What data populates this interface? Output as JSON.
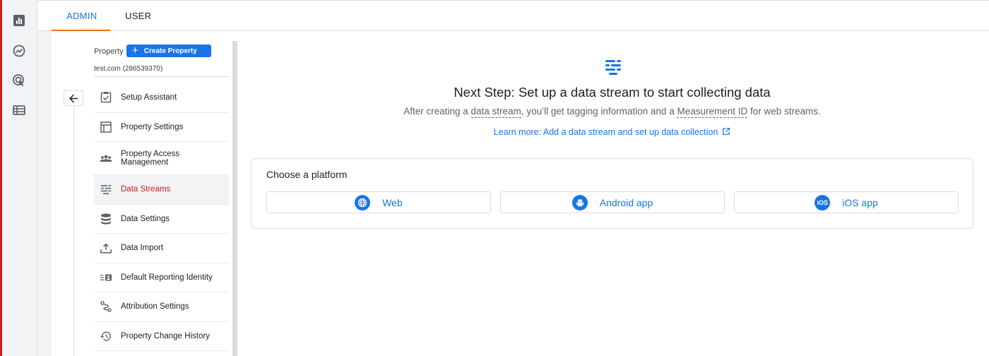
{
  "tabs": [
    {
      "label": "ADMIN"
    },
    {
      "label": "USER"
    }
  ],
  "property": {
    "label": "Property",
    "create_label": "Create Property",
    "name": "test.com (286539370)"
  },
  "menu": [
    {
      "label": "Setup Assistant",
      "icon": "checklist-icon"
    },
    {
      "label": "Property Settings",
      "icon": "property-settings-icon"
    },
    {
      "label": "Property Access\nManagement",
      "icon": "people-icon"
    },
    {
      "label": "Data Streams",
      "icon": "data-streams-icon",
      "active": true
    },
    {
      "label": "Data Settings",
      "icon": "database-icon"
    },
    {
      "label": "Data Import",
      "icon": "upload-icon"
    },
    {
      "label": "Default Reporting Identity",
      "icon": "reporting-identity-icon"
    },
    {
      "label": "Attribution Settings",
      "icon": "attribution-icon"
    },
    {
      "label": "Property Change History",
      "icon": "history-icon"
    }
  ],
  "hero": {
    "title": "Next Step: Set up a data stream to start collecting data",
    "sub_1": "After creating a ",
    "sub_term_1": "data stream",
    "sub_2": ", you’ll get tagging information and a ",
    "sub_term_2": "Measurement ID",
    "sub_3": " for web streams.",
    "learn_more": "Learn more: Add a data stream and set up data collection"
  },
  "platform": {
    "title": "Choose a platform",
    "buttons": [
      {
        "label": "Web",
        "icon": "globe-icon"
      },
      {
        "label": "Android app",
        "icon": "android-icon"
      },
      {
        "label": "iOS app",
        "icon": "ios-icon",
        "icon_text": "iOS"
      }
    ]
  },
  "colors": {
    "accent": "#1a73e8",
    "active": "#c5221f",
    "tab_indicator": "#e8710a"
  }
}
